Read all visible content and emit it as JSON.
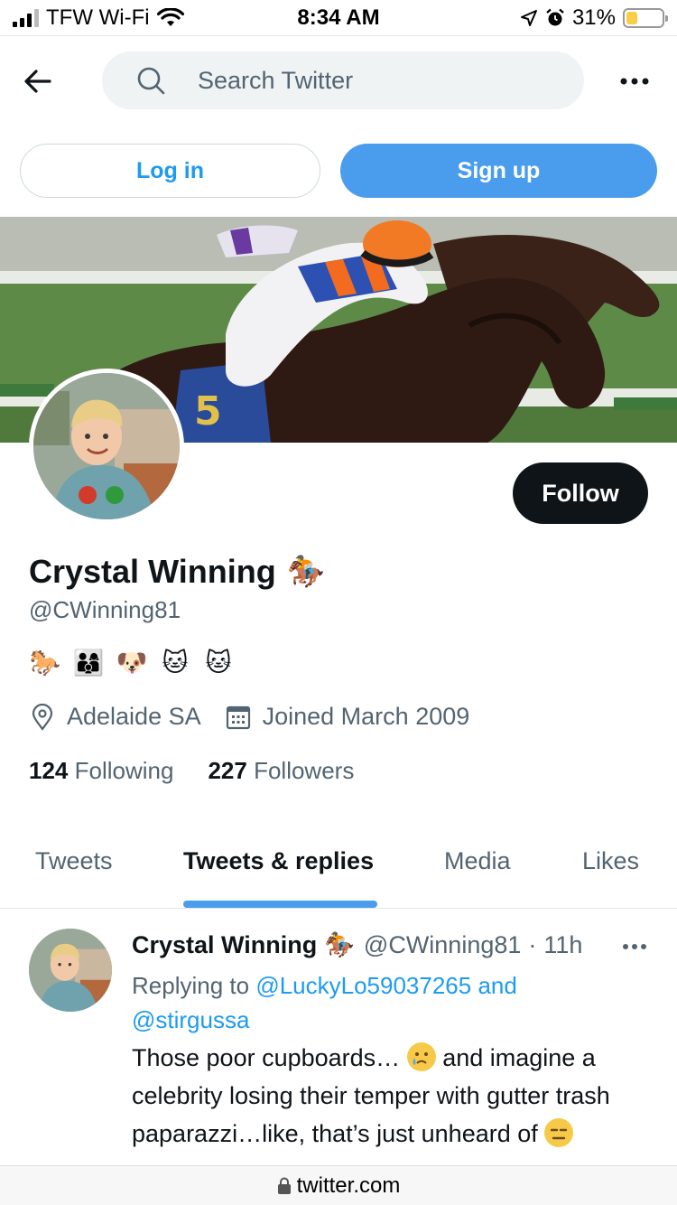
{
  "status_bar": {
    "carrier": "TFW Wi-Fi",
    "time": "8:34 AM",
    "battery_percent": "31%",
    "battery_level": 0.31,
    "battery_color": "#f7ce46"
  },
  "top_bar": {
    "search_placeholder": "Search Twitter",
    "back_icon": "arrow-left-icon",
    "more_icon": "more-horizontal-icon"
  },
  "auth": {
    "login_label": "Log in",
    "signup_label": "Sign up"
  },
  "profile": {
    "display_name": "Crystal Winning",
    "name_emoji": "🏇",
    "handle": "@CWinning81",
    "follow_label": "Follow",
    "bio_emojis": [
      "🐎",
      "👨‍👩‍👦",
      "🐶",
      "🐱",
      "🐱"
    ],
    "location": "Adelaide SA",
    "joined": "Joined March 2009",
    "following_count": "124",
    "following_label": "Following",
    "followers_count": "227",
    "followers_label": "Followers"
  },
  "tabs": [
    {
      "label": "Tweets"
    },
    {
      "label": "Tweets & replies"
    },
    {
      "label": "Media"
    },
    {
      "label": "Likes"
    }
  ],
  "active_tab": "Tweets & replies",
  "tweet": {
    "author_name": "Crystal Winning",
    "author_emoji": "🏇",
    "author_handle": "@CWinning81",
    "separator": "·",
    "time": "11h",
    "replying_prefix": "Replying to",
    "reply_target_1": "@LuckyLo59037265",
    "reply_and": "and",
    "reply_target_2": "@stirgussa",
    "text_1": "Those poor cupboards…",
    "text_2": "and imagine a celebrity losing their temper with gutter trash paparazzi…like, that’s just unheard of"
  },
  "url_bar": {
    "domain": "twitter.com"
  },
  "colors": {
    "accent": "#1d9bf0",
    "signup_bg": "#4a9ded",
    "follow_bg": "#0f1419",
    "muted_text": "#536471"
  }
}
